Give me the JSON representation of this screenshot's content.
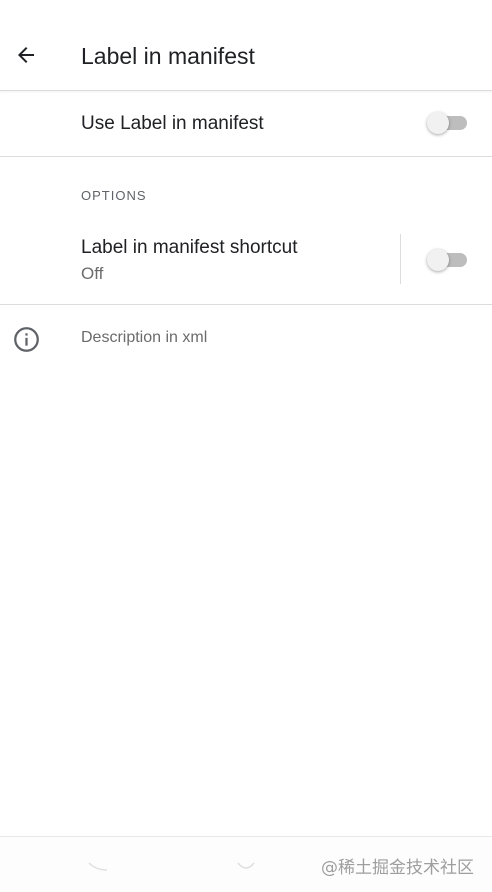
{
  "appbar": {
    "title": "Label in manifest",
    "back_icon": "arrow-back-icon"
  },
  "master_switch": {
    "label": "Use Label in manifest",
    "checked": false
  },
  "options_section": {
    "header": "OPTIONS",
    "items": [
      {
        "title": "Label in manifest shortcut",
        "summary": "Off",
        "checked": false
      }
    ]
  },
  "footer": {
    "icon": "info-icon",
    "text": "Description in xml"
  },
  "system_nav": {
    "watermark": "@稀土掘金技术社区"
  },
  "colors": {
    "text_primary": "#202124",
    "text_secondary": "#6b6b6b",
    "divider": "#dcdcdc",
    "switch_track_off": "#bdbdbd",
    "switch_thumb_off": "#f1f1f1"
  }
}
